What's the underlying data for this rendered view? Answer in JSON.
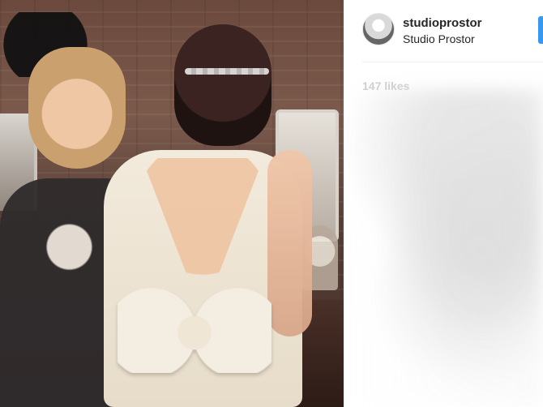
{
  "post": {
    "username": "studioprostor",
    "display_name": "Studio Prostor",
    "likes_text": "147 likes"
  },
  "icons": {
    "avatar": "avatar-icon"
  },
  "colors": {
    "accent": "#3897f0",
    "text": "#262626",
    "divider": "#efefef"
  }
}
